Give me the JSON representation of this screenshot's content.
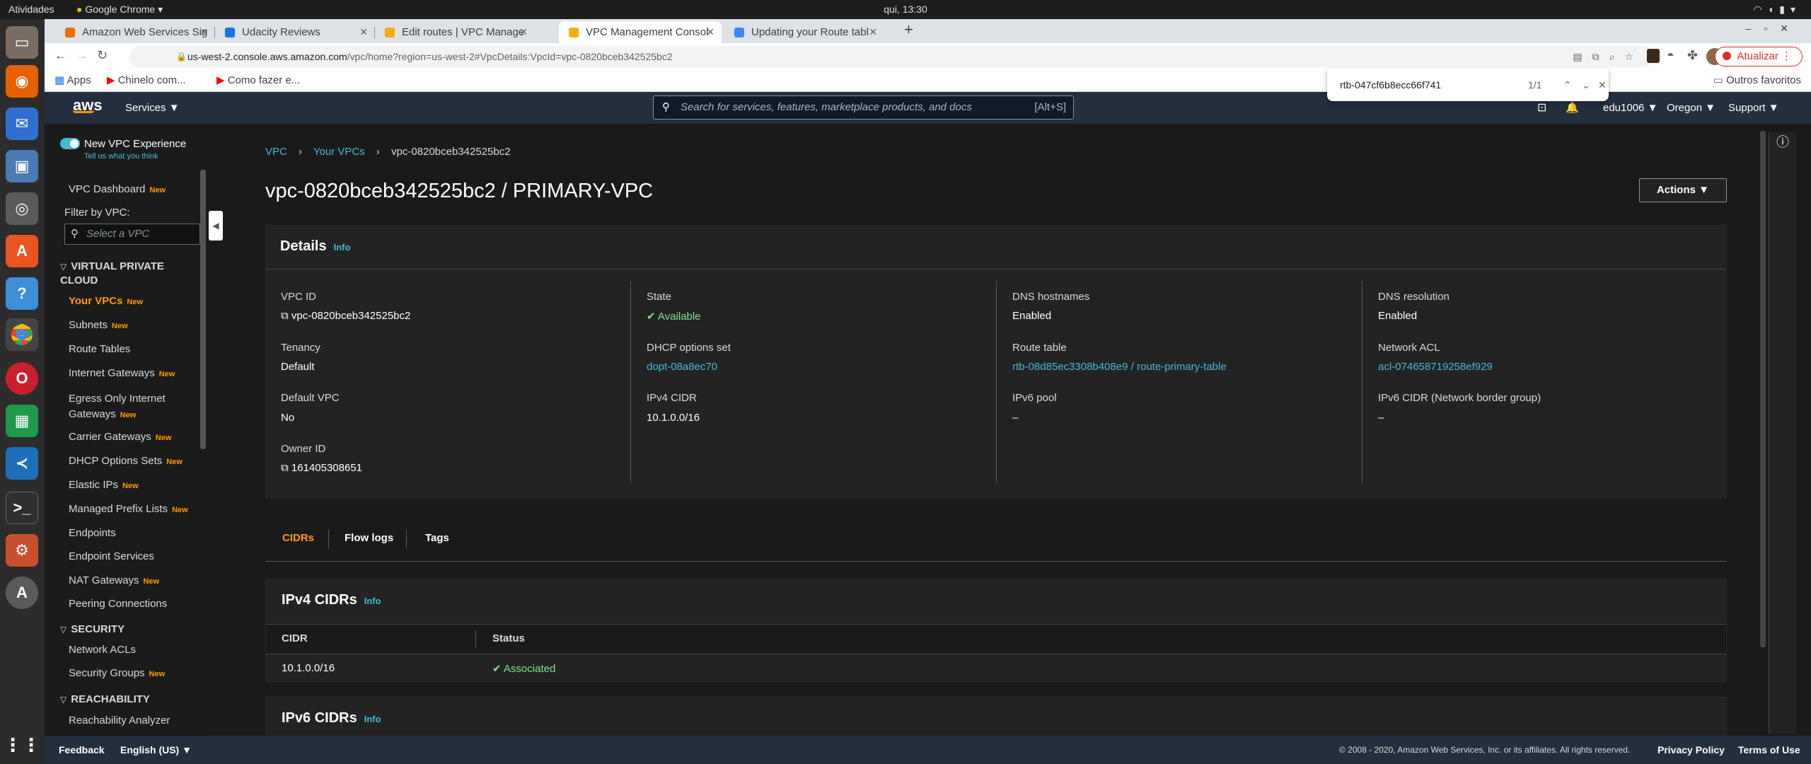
{
  "os": {
    "activities": "Atividades",
    "app_name": "Google Chrome",
    "clock": "qui, 13:30"
  },
  "browser": {
    "tabs": [
      {
        "label": "Amazon Web Services Sig",
        "color": "#e8710a"
      },
      {
        "label": "Udacity Reviews",
        "color": "#1a73e8"
      },
      {
        "label": "Edit routes | VPC Manage",
        "color": "#f9ab00"
      },
      {
        "label": "VPC Management Consol",
        "color": "#f9ab00"
      },
      {
        "label": "Updating your Route tabl",
        "color": "#4285f4"
      }
    ],
    "new_tab": "+",
    "url_host": "us-west-2.console.aws.amazon.com",
    "url_path": "/vpc/home?region=us-west-2#VpcDetails:VpcId=vpc-0820bceb342525bc2",
    "update_label": "Atualizar",
    "bookmarks": [
      "Apps",
      "Chinelo com...",
      "Como fazer e..."
    ],
    "other_bookmarks": "Outros favoritos",
    "find": {
      "query": "rtb-047cf6b8ecc66f741",
      "count": "1/1"
    }
  },
  "aws_header": {
    "logo": "aws",
    "services": "Services",
    "search_placeholder": "Search for services, features, marketplace products, and docs",
    "search_shortcut": "[Alt+S]",
    "user": "edu1006",
    "region": "Oregon",
    "support": "Support"
  },
  "sidebar": {
    "toggle_label": "New VPC Experience",
    "toggle_sub": "Tell us what you think",
    "dashboard": "VPC Dashboard",
    "new": "New",
    "filter_label": "Filter by VPC:",
    "filter_placeholder": "Select a VPC",
    "sec_vpc": "VIRTUAL PRIVATE CLOUD",
    "items": [
      {
        "label": "Your VPCs",
        "new": "New"
      },
      {
        "label": "Subnets",
        "new": "New"
      },
      {
        "label": "Route Tables",
        "new": ""
      },
      {
        "label": "Internet Gateways",
        "new": "New"
      },
      {
        "label": "Egress Only Internet",
        "label2": "Gateways",
        "new": "New"
      },
      {
        "label": "Carrier Gateways",
        "new": "New"
      },
      {
        "label": "DHCP Options Sets",
        "new": "New"
      },
      {
        "label": "Elastic IPs",
        "new": "New"
      },
      {
        "label": "Managed Prefix Lists",
        "new": "New"
      },
      {
        "label": "Endpoints",
        "new": ""
      },
      {
        "label": "Endpoint Services",
        "new": ""
      },
      {
        "label": "NAT Gateways",
        "new": "New"
      },
      {
        "label": "Peering Connections",
        "new": ""
      }
    ],
    "sec_security": "SECURITY",
    "security_items": [
      {
        "label": "Network ACLs",
        "new": ""
      },
      {
        "label": "Security Groups",
        "new": "New"
      }
    ],
    "sec_reach": "REACHABILITY",
    "reach_items": [
      {
        "label": "Reachability Analyzer",
        "new": ""
      }
    ]
  },
  "breadcrumb": [
    "VPC",
    "Your VPCs",
    "vpc-0820bceb342525bc2"
  ],
  "page_title": "vpc-0820bceb342525bc2 / PRIMARY-VPC",
  "actions_label": "Actions",
  "details": {
    "title": "Details",
    "info": "Info",
    "vpc_id_label": "VPC ID",
    "vpc_id": "vpc-0820bceb342525bc2",
    "tenancy_label": "Tenancy",
    "tenancy": "Default",
    "default_vpc_label": "Default VPC",
    "default_vpc": "No",
    "owner_label": "Owner ID",
    "owner": "161405308651",
    "state_label": "State",
    "state": "Available",
    "dhcp_label": "DHCP options set",
    "dhcp": "dopt-08a8ec70",
    "ipv4_label": "IPv4 CIDR",
    "ipv4": "10.1.0.0/16",
    "dns_host_label": "DNS hostnames",
    "dns_host": "Enabled",
    "route_label": "Route table",
    "route": "rtb-08d85ec3308b408e9 / route-primary-table",
    "ipv6pool_label": "IPv6 pool",
    "ipv6pool": "–",
    "dns_res_label": "DNS resolution",
    "dns_res": "Enabled",
    "acl_label": "Network ACL",
    "acl": "acl-074658719258ef929",
    "ipv6cidr_label": "IPv6 CIDR (Network border group)",
    "ipv6cidr": "–"
  },
  "tabs": [
    "CIDRs",
    "Flow logs",
    "Tags"
  ],
  "ipv4_cidrs": {
    "title": "IPv4 CIDRs",
    "info": "Info",
    "columns": [
      "CIDR",
      "Status"
    ],
    "rows": [
      {
        "cidr": "10.1.0.0/16",
        "status": "Associated"
      }
    ]
  },
  "ipv6_cidrs": {
    "title": "IPv6 CIDRs",
    "info": "Info"
  },
  "footer": {
    "feedback": "Feedback",
    "language": "English (US)",
    "copyright": "© 2008 - 2020, Amazon Web Services, Inc. or its affiliates. All rights reserved.",
    "privacy": "Privacy Policy",
    "terms": "Terms of Use"
  }
}
